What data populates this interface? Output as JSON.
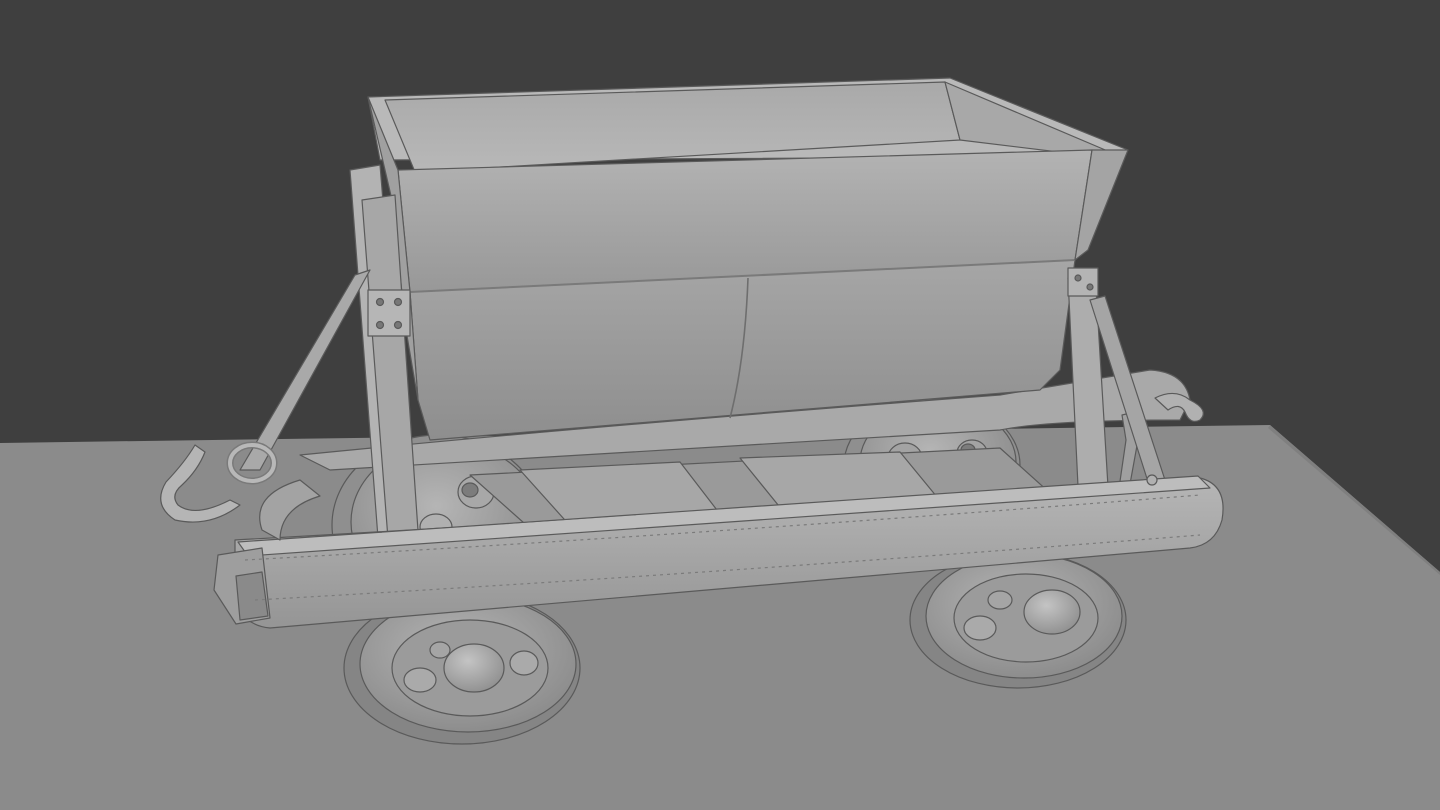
{
  "viewport": {
    "shading": "solid",
    "object": "mine-cart-model",
    "colors": {
      "background": "#3f3f3f",
      "ground": "#8b8b8b",
      "ground_edge": "#7f7f7f",
      "model_light": "#b9b9b9",
      "model_mid": "#a2a2a2",
      "model_dark": "#888888",
      "model_shadow": "#6f6f6f",
      "outline": "#5a5a5a"
    }
  }
}
